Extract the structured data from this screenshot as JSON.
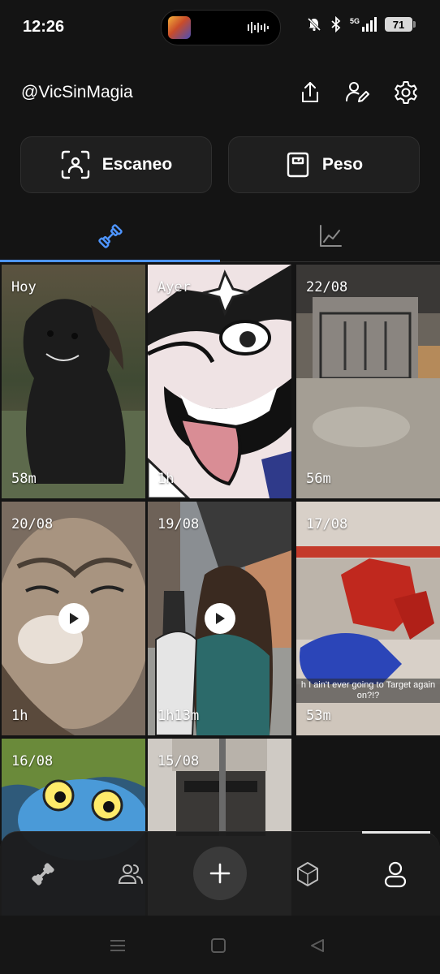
{
  "status_bar": {
    "time": "12:26",
    "network_label": "5G",
    "battery": "71"
  },
  "header": {
    "username": "@VicSinMagia",
    "icons": [
      "share-icon",
      "edit-profile-icon",
      "gear-icon"
    ]
  },
  "actions": {
    "scan_label": "Escaneo",
    "weight_label": "Peso"
  },
  "tabs": [
    {
      "name": "workouts",
      "icon": "dumbbell-icon",
      "active": true
    },
    {
      "name": "stats",
      "icon": "line-chart-icon",
      "active": false
    }
  ],
  "grid": [
    {
      "date": "Hoy",
      "duration": "58m",
      "video": false
    },
    {
      "date": "Ayer",
      "duration": "1h",
      "video": false
    },
    {
      "date": "22/08",
      "duration": "56m",
      "video": false
    },
    {
      "date": "20/08",
      "duration": "1h",
      "video": true
    },
    {
      "date": "19/08",
      "duration": "1h13m",
      "video": true
    },
    {
      "date": "17/08",
      "duration": "53m",
      "video": false,
      "caption": "h I ain't ever going to Target again on?!?"
    },
    {
      "date": "16/08",
      "duration": "",
      "video": false
    },
    {
      "date": "15/08",
      "duration": "",
      "video": false
    }
  ],
  "bottom_nav": [
    {
      "icon": "dumbbell-icon"
    },
    {
      "icon": "people-icon"
    },
    {
      "icon": "plus-icon"
    },
    {
      "icon": "hexagon-icon"
    },
    {
      "icon": "profile-icon",
      "active": true
    }
  ],
  "colors": {
    "accent": "#4e95ff",
    "background": "#141414"
  }
}
